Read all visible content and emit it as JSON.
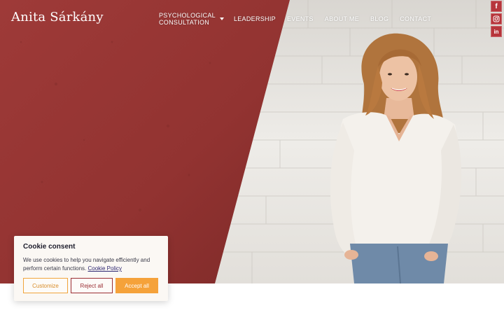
{
  "site": {
    "logo": "Anita Sárkány"
  },
  "nav": {
    "psychological_line1": "PSYCHOLOGICAL",
    "psychological_line2": "CONSULTATION",
    "items": [
      {
        "label": "LEADERSHIP"
      },
      {
        "label": "EVENTS"
      },
      {
        "label": "ABOUT ME"
      },
      {
        "label": "BLOG"
      },
      {
        "label": "CONTACT"
      }
    ]
  },
  "social": [
    {
      "icon": "facebook-icon",
      "glyph": "f"
    },
    {
      "icon": "instagram-icon"
    },
    {
      "icon": "linkedin-icon",
      "glyph": "in"
    }
  ],
  "colors": {
    "brand_red": "#9c3435",
    "accent_orange": "#f5a23a",
    "social_bg": "#b7353b"
  },
  "cookie": {
    "title": "Cookie consent",
    "text": "We use cookies to help you navigate efficiently and perform certain functions.",
    "policy_link": "Cookie Policy",
    "customize_label": "Customize",
    "reject_label": "Reject all",
    "accept_label": "Accept all"
  }
}
